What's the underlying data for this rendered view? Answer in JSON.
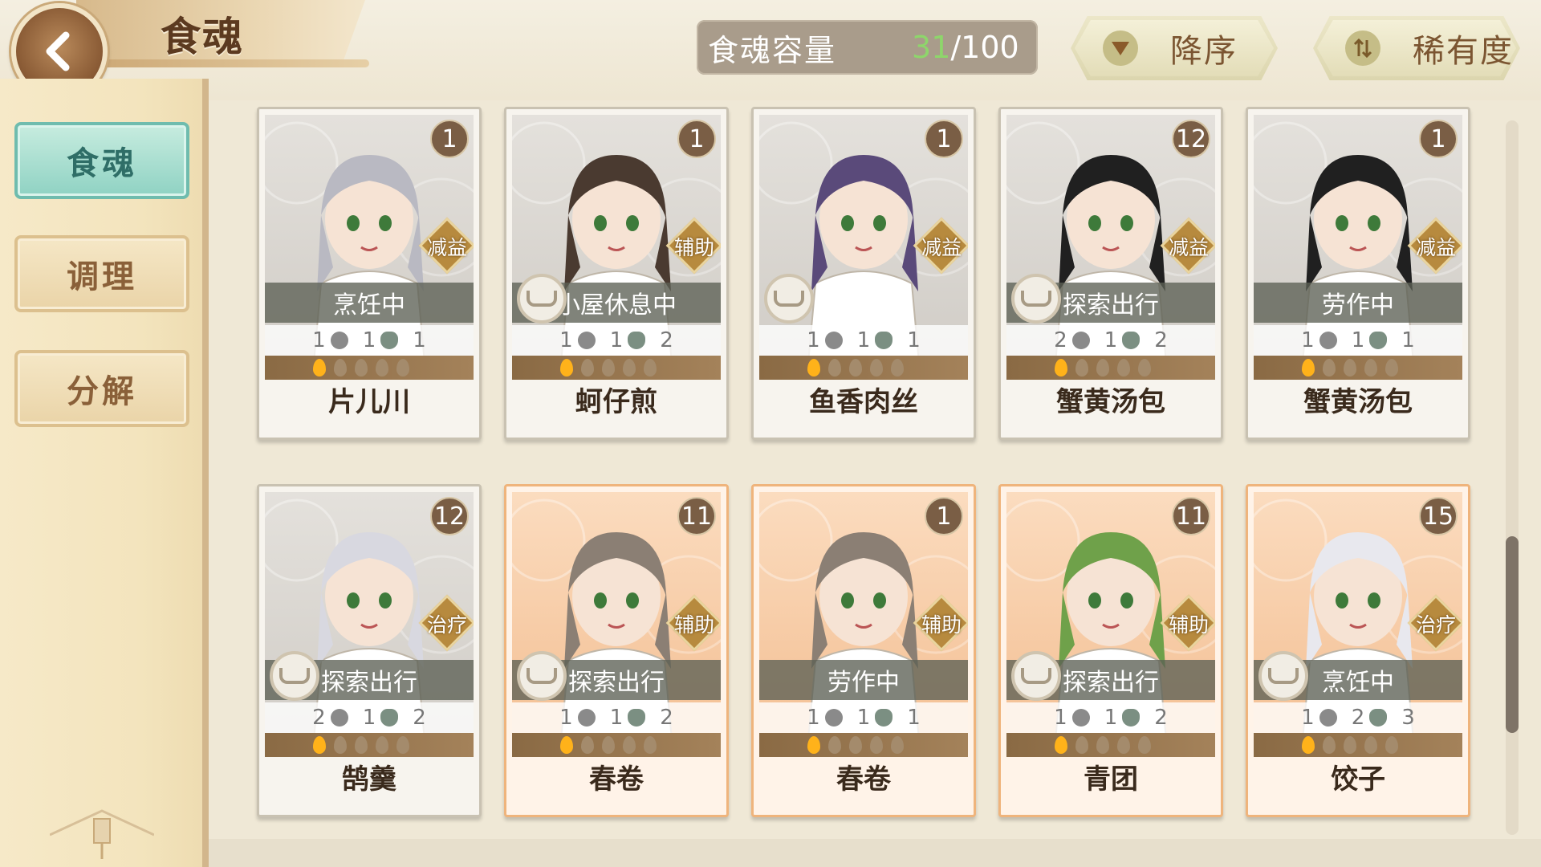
{
  "header": {
    "title": "食魂",
    "capacity_label": "食魂容量",
    "capacity_current": "31",
    "capacity_max": "/100",
    "sort_order_label": "降序",
    "sort_rarity_label": "稀有度"
  },
  "sidebar": {
    "tabs": [
      {
        "label": "食魂",
        "active": true
      },
      {
        "label": "调理",
        "active": false
      },
      {
        "label": "分解",
        "active": false
      }
    ]
  },
  "cards": [
    {
      "name": "片儿川",
      "level": "1",
      "role": "减益",
      "status": "烹饪中",
      "home_badge": false,
      "stat_a": "1",
      "stat_b": "1",
      "stat_c": "1",
      "frame": "gray"
    },
    {
      "name": "蚵仔煎",
      "level": "1",
      "role": "辅助",
      "status": "小屋休息中",
      "home_badge": true,
      "stat_a": "1",
      "stat_b": "1",
      "stat_c": "2",
      "frame": "gray"
    },
    {
      "name": "鱼香肉丝",
      "level": "1",
      "role": "减益",
      "status": "",
      "home_badge": true,
      "stat_a": "1",
      "stat_b": "1",
      "stat_c": "1",
      "frame": "gray"
    },
    {
      "name": "蟹黄汤包",
      "level": "12",
      "role": "减益",
      "status": "探索出行",
      "home_badge": true,
      "stat_a": "2",
      "stat_b": "1",
      "stat_c": "2",
      "frame": "gray"
    },
    {
      "name": "蟹黄汤包",
      "level": "1",
      "role": "减益",
      "status": "劳作中",
      "home_badge": false,
      "stat_a": "1",
      "stat_b": "1",
      "stat_c": "1",
      "frame": "gray"
    },
    {
      "name": "鹄羹",
      "level": "12",
      "role": "治疗",
      "status": "探索出行",
      "home_badge": true,
      "stat_a": "2",
      "stat_b": "1",
      "stat_c": "2",
      "frame": "gray"
    },
    {
      "name": "春卷",
      "level": "11",
      "role": "辅助",
      "status": "探索出行",
      "home_badge": true,
      "stat_a": "1",
      "stat_b": "1",
      "stat_c": "2",
      "frame": "orange"
    },
    {
      "name": "春卷",
      "level": "1",
      "role": "辅助",
      "status": "劳作中",
      "home_badge": false,
      "stat_a": "1",
      "stat_b": "1",
      "stat_c": "1",
      "frame": "orange"
    },
    {
      "name": "青团",
      "level": "11",
      "role": "辅助",
      "status": "探索出行",
      "home_badge": true,
      "stat_a": "1",
      "stat_b": "1",
      "stat_c": "2",
      "frame": "orange"
    },
    {
      "name": "饺子",
      "level": "15",
      "role": "治疗",
      "status": "烹饪中",
      "home_badge": true,
      "stat_a": "1",
      "stat_b": "2",
      "stat_c": "3",
      "frame": "orange"
    }
  ],
  "icons": {
    "back": "chevron-left-icon",
    "sort_order": "triangle-down-icon",
    "sort_rarity": "swap-vertical-icon",
    "home": "cup-icon"
  },
  "colors": {
    "capacity_current": "#8ed66b",
    "active_tab": "#8fd2c3",
    "orange_frame": "#efb47c"
  }
}
